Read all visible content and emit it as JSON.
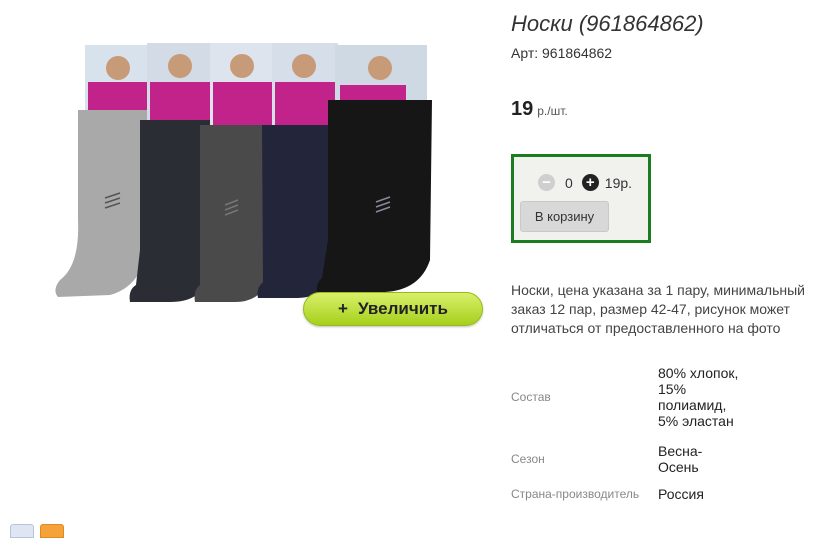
{
  "product": {
    "title": "Носки (961864862)",
    "sku": "Арт: 961864862",
    "price_value": "19",
    "price_unit": "р./шт.",
    "description": "Носки, цена указана за 1 пару, минимальный заказ 12 пар, размер 42-47, рисунок может отличаться от предоставленного на фото",
    "zoom_label": "Увеличить",
    "zoom_plus": "+"
  },
  "cart": {
    "minus_icon": "−",
    "plus_icon": "+",
    "quantity": "0",
    "sum": "19р.",
    "add_label": "В корзину",
    "border_color": "#1b7d1f"
  },
  "properties": [
    {
      "key": "Состав",
      "value": "80% хлопок, 15% полиамид, 5% эластан"
    },
    {
      "key": "Сезон",
      "value": "Весна-Осень"
    },
    {
      "key": "Страна-производитель",
      "value": "Россия"
    }
  ],
  "image": {
    "sock_colors": [
      "#a9a9a9",
      "#2a2d33",
      "#4a4a4a",
      "#23253a",
      "#161616"
    ],
    "shirt_color": "#c2238a"
  }
}
